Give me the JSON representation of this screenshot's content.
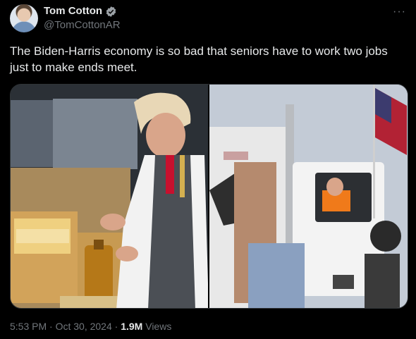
{
  "author": {
    "display_name": "Tom Cotton",
    "handle": "@TomCottonAR"
  },
  "tweet": {
    "text": "The Biden-Harris economy is so bad that seniors have to work two jobs just to make ends meet.",
    "time": "5:53 PM",
    "date": "Oct 30, 2024",
    "views_count": "1.9M",
    "views_label": "Views"
  },
  "colors": {
    "verified_badge": "#9ba1a6",
    "background": "#000000",
    "muted_text": "#71767b"
  },
  "icons": {
    "verified": "verified-badge-icon",
    "more": "more-options-icon"
  }
}
